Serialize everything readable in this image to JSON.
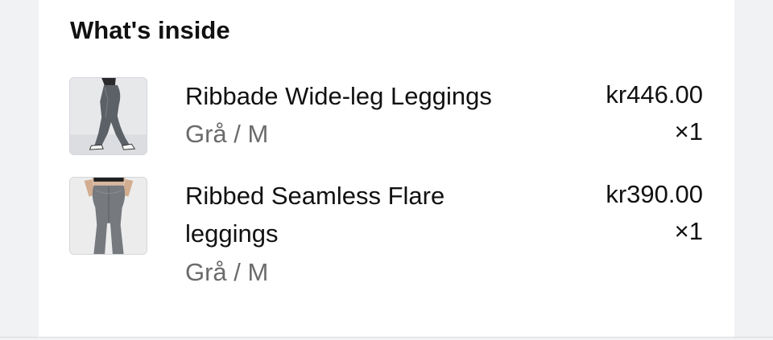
{
  "section": {
    "title": "What's inside"
  },
  "items": [
    {
      "name": "Ribbade Wide-leg Leggings",
      "variant": "Grå / M",
      "price": "kr446.00",
      "quantity": "×1",
      "image_icon": "product-photo-leggings-side"
    },
    {
      "name": "Ribbed Seamless Flare leggings",
      "variant": "Grå / M",
      "price": "kr390.00",
      "quantity": "×1",
      "image_icon": "product-photo-leggings-back"
    }
  ],
  "colors": {
    "background": "#f1f2f4",
    "panel": "#ffffff",
    "text": "#111111",
    "muted_text": "#6b6b6b"
  }
}
